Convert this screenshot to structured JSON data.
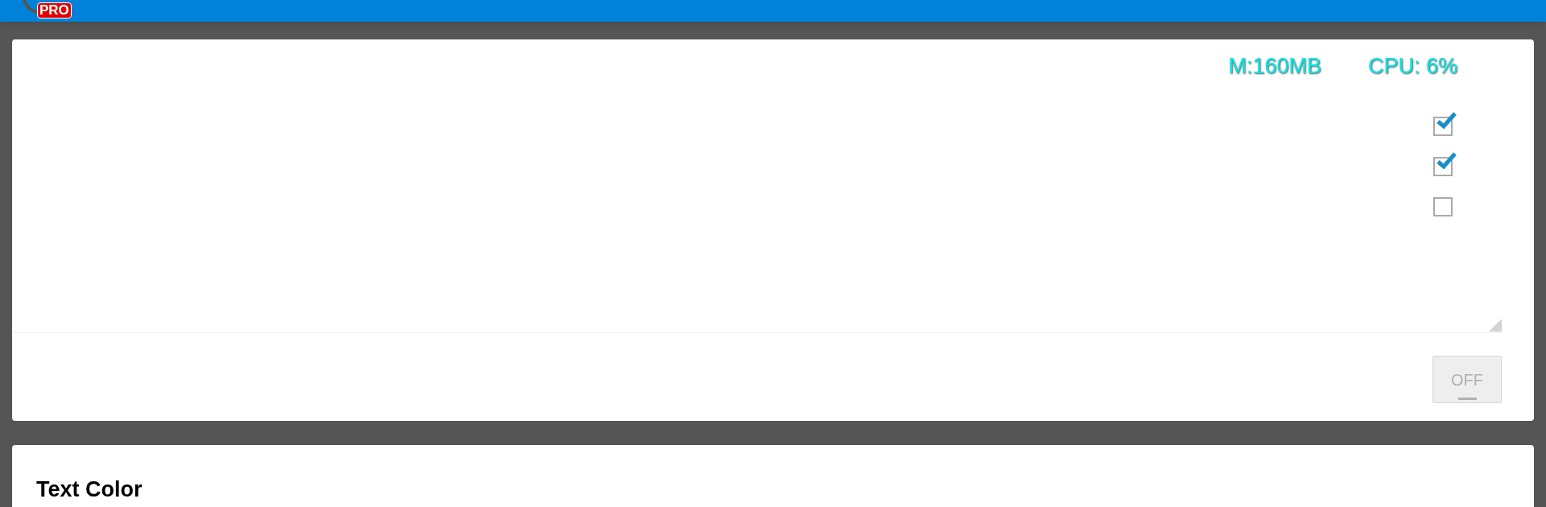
{
  "app_bar": {
    "badge": "PRO"
  },
  "monitor": {
    "memory": "M:160MB",
    "cpu": "CPU: 6%",
    "checkboxes": [
      {
        "checked": true
      },
      {
        "checked": true
      },
      {
        "checked": false
      }
    ],
    "toggle": {
      "label": "OFF",
      "on": false
    }
  },
  "text_color_card": {
    "title": "Text Color"
  }
}
